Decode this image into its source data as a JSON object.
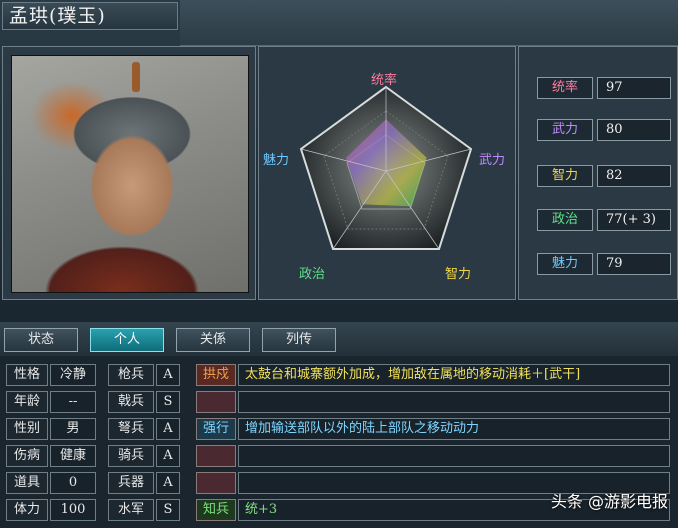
{
  "header": {
    "title": "孟珙(璞玉)"
  },
  "radar": {
    "labels": {
      "top": "统率",
      "right": "武力",
      "bottom_right": "智力",
      "bottom_left": "政治",
      "left": "魅力"
    },
    "label_colors": {
      "top": "#ff7aa0",
      "right": "#c08aff",
      "bottom_right": "#f2d64a",
      "bottom_left": "#5fe08a",
      "left": "#6fc8ff"
    }
  },
  "stats": [
    {
      "label": "统率",
      "value": "97",
      "color": "#ff7aa0"
    },
    {
      "label": "武力",
      "value": "80",
      "color": "#c08aff"
    },
    {
      "label": "智力",
      "value": "82",
      "color": "#f2d64a"
    },
    {
      "label": "政治",
      "value": "77(+ 3)",
      "color": "#5fe08a"
    },
    {
      "label": "魅力",
      "value": "79",
      "color": "#6fc8ff"
    }
  ],
  "tabs": [
    {
      "label": "状态"
    },
    {
      "label": "个人"
    },
    {
      "label": "关係"
    },
    {
      "label": "列传"
    }
  ],
  "personal": [
    {
      "label": "性格",
      "value": "冷静"
    },
    {
      "label": "年龄",
      "value": "--"
    },
    {
      "label": "性别",
      "value": "男"
    },
    {
      "label": "伤病",
      "value": "健康"
    },
    {
      "label": "道具",
      "value": "0"
    },
    {
      "label": "体力",
      "value": "100"
    }
  ],
  "aptitudes": [
    {
      "label": "枪兵",
      "grade": "A"
    },
    {
      "label": "戟兵",
      "grade": "S"
    },
    {
      "label": "弩兵",
      "grade": "A"
    },
    {
      "label": "骑兵",
      "grade": "A"
    },
    {
      "label": "兵器",
      "grade": "A"
    },
    {
      "label": "水军",
      "grade": "S"
    }
  ],
  "skills": [
    {
      "name": "拱戍",
      "desc": "太鼓台和城寨额外加成，增加敌在属地的移动消耗＋[武干]",
      "name_color": "#f2a050",
      "desc_color": "#f2e05a"
    },
    {
      "name": "",
      "desc": "",
      "name_color": "#e8e8e8",
      "desc_color": "#e8e8e8"
    },
    {
      "name": "强行",
      "desc": "增加输送部队以外的陆上部队之移动动力",
      "name_color": "#7fd6ff",
      "desc_color": "#7fd6ff"
    },
    {
      "name": "",
      "desc": "",
      "name_color": "#e8e8e8",
      "desc_color": "#e8e8e8"
    },
    {
      "name": "",
      "desc": "",
      "name_color": "#e8e8e8",
      "desc_color": "#e8e8e8"
    },
    {
      "name": "知兵",
      "desc": "统+3",
      "name_color": "#7fe07f",
      "desc_color": "#7fe07f"
    }
  ],
  "watermark": "头条 @游影电报"
}
